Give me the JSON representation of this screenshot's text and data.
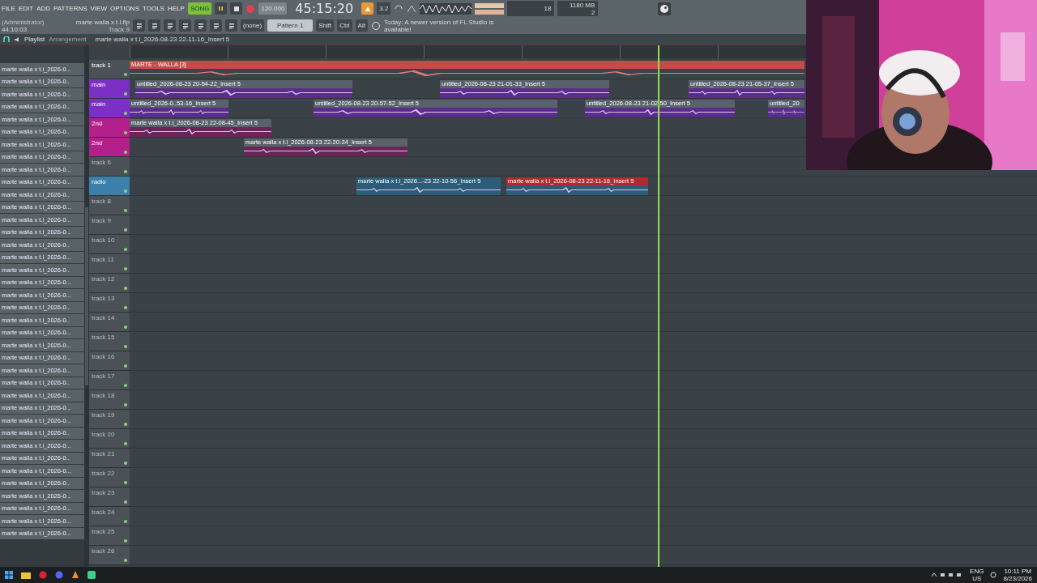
{
  "menu": [
    "FILE",
    "EDIT",
    "ADD",
    "PATTERNS",
    "VIEW",
    "OPTIONS",
    "TOOLS",
    "HELP"
  ],
  "transport": {
    "mode": "SONG",
    "playing": true,
    "tempo": "120.000",
    "time": "45:15:20",
    "monitor": "3.2"
  },
  "cpu": {
    "value": "18",
    "memory": "1180 MB",
    "polyphony": "2"
  },
  "project": {
    "user": "(Administrator)",
    "file": "marte walla x t.l.flp",
    "elapsed": "44:10:03",
    "hint": "Track 9"
  },
  "pattern": {
    "mixer": "(none)",
    "name": "Pattern 1"
  },
  "keys": [
    "Shift",
    "Ctrl",
    "Alt"
  ],
  "news": "Today: A newer version of FL Studio is available!",
  "playlist": {
    "title": "Playlist",
    "section": "Arrangement",
    "clip_path": "marte walla x t.l_2026-08-23 22-11-16_Insert 5"
  },
  "browser": [
    "marte walla x t.l_2026-0...",
    "marte walla x t.l_2026-0..",
    "marte walla x t.l_2026-0...",
    "marte walla x t.l_2026-0..",
    "marte walla x t.l_2026-0...",
    "marte walla x t.l_2026-0..",
    "marte walla x t.l_2026-0...",
    "marte walla x t.l_2026-0...",
    "marte walla x t.l_2026-0...",
    "marte walla x t.l_2026-0...",
    "marte walla x t.l_2026-0..",
    "marte walla x t.l_2026-0...",
    "marte walla x t.l_2026-0...",
    "marte walla x t.l_2026-0...",
    "marte walla x t.l_2026-0..",
    "marte walla x t.l_2026-0...",
    "marte walla x t.l_2026-0..",
    "marte walla x t.l_2026-0...",
    "marte walla x t.l_2026-0...",
    "marte walla x t.l_2026-0..",
    "marte walla x t.l_2026-0..",
    "marte walla x t.l_2026-0...",
    "marte walla x t.l_2026-0...",
    "marte walla x t.l_2026-0...",
    "marte walla x t.l_2026-0...",
    "marte walla x t.l_2026-0..",
    "marte walla x t.l_2026-0...",
    "marte walla x t.l_2026-0...",
    "marte walla x t.l_2026-0...",
    "marte walla x t.l_2026-0..",
    "marte walla x t.l_2026-0...",
    "marte walla x t.l_2026-0..",
    "marte walla x t.l_2026-0...",
    "marte walla x t.l_2026-0..",
    "marte walla x t.l_2026-0...",
    "marte walla x t.l_2026-0...",
    "marte walla x t.l_2026-0...",
    "marte walla x t.l_2026-0..."
  ],
  "tracks": [
    {
      "name": "track 1",
      "color": "#4a5258",
      "clips": [
        {
          "label": "MARTE - WALLA [3]",
          "color": "#c84a48"
        }
      ]
    },
    {
      "name": "main",
      "color": "#7b2fc4",
      "clips": [
        {
          "label": "untitled_2026-08-23 20-54-22_Insert 5",
          "color": "#5a2d8c"
        },
        {
          "label": "untitled_2026-08-23 21-01-33_Insert 5",
          "color": "#5a2d8c"
        },
        {
          "label": "untitled_2026-08-23 21-05-37_Insert 5",
          "color": "#5a2d8c"
        }
      ]
    },
    {
      "name": "main",
      "color": "#7b2fc4",
      "clips": [
        {
          "label": "untitled_2026-0..53-16_Insert 5",
          "color": "#5a2d8c"
        },
        {
          "label": "untitled_2026-08-23 20-57-52_Insert 5",
          "color": "#5a2d8c"
        },
        {
          "label": "untitled_2026-08-23 21-02-50_Insert 5",
          "color": "#5a2d8c"
        },
        {
          "label": "untitled_20",
          "color": "#5a2d8c"
        }
      ]
    },
    {
      "name": "2nd",
      "color": "#b3208c",
      "clips": [
        {
          "label": "marte walla x t.l_2026-08-23 22-08-45_Insert 5",
          "color": "#6a2458"
        }
      ]
    },
    {
      "name": "2nd",
      "color": "#b3208c",
      "clips": [
        {
          "label": "marte walla x t.l_2026-08-23 22-20-24_Insert 5",
          "color": "#6a2458"
        }
      ]
    },
    {
      "name": "track 6",
      "color": "#4a5258"
    },
    {
      "name": "radio",
      "color": "#3b80aa",
      "clips": [
        {
          "label": "marte walla x t.l_2026...-23 22-10-56_Insert 5",
          "color": "#2b5c78"
        },
        {
          "label": "marte walla x t.l_2026-08-23 22-11-16_Insert 5",
          "color": "#b02a30"
        }
      ]
    },
    {
      "name": "track 8",
      "color": "#4a5258"
    },
    {
      "name": "track 9",
      "color": "#4a5258"
    },
    {
      "name": "track 10",
      "color": "#4a5258"
    },
    {
      "name": "track 11",
      "color": "#4a5258"
    },
    {
      "name": "track 12",
      "color": "#4a5258"
    },
    {
      "name": "track 13",
      "color": "#4a5258"
    },
    {
      "name": "track 14",
      "color": "#4a5258"
    },
    {
      "name": "track 15",
      "color": "#4a5258"
    },
    {
      "name": "track 16",
      "color": "#4a5258"
    },
    {
      "name": "track 17",
      "color": "#4a5258"
    },
    {
      "name": "track 18",
      "color": "#4a5258"
    },
    {
      "name": "track 19",
      "color": "#4a5258"
    },
    {
      "name": "track 20",
      "color": "#4a5258"
    },
    {
      "name": "track 21",
      "color": "#4a5258"
    },
    {
      "name": "track 22",
      "color": "#4a5258"
    },
    {
      "name": "track 23",
      "color": "#4a5258"
    },
    {
      "name": "track 24",
      "color": "#4a5258"
    },
    {
      "name": "track 25",
      "color": "#4a5258"
    },
    {
      "name": "track 26",
      "color": "#4a5258"
    }
  ],
  "taskbar": {
    "language": "ENG",
    "region": "US",
    "time": "10:11 PM",
    "date": "8/23/2026"
  }
}
